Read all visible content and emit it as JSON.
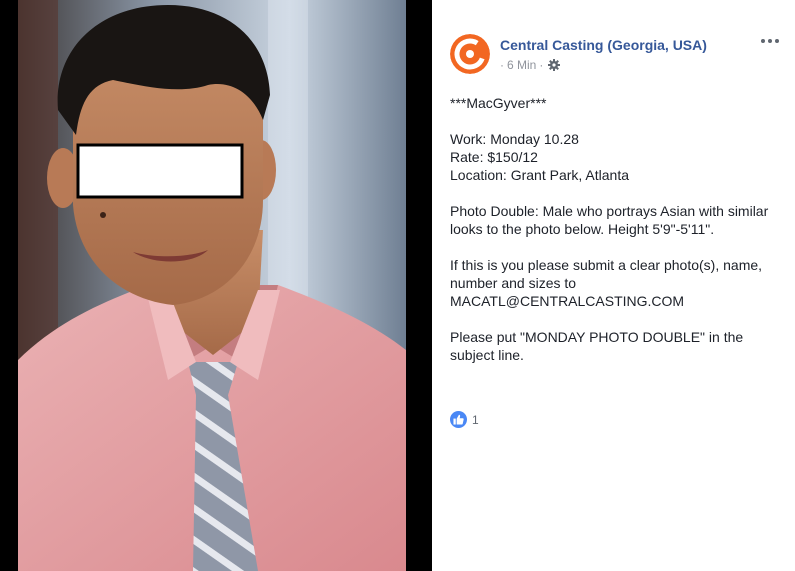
{
  "post": {
    "page_name": "Central Casting (Georgia, USA)",
    "meta_time": "6 Min",
    "meta_separator": "·",
    "lines": {
      "title": "***MacGyver***",
      "work": "Work: Monday 10.28",
      "rate": "Rate: $150/12",
      "location": "Location: Grant Park, Atlanta",
      "desc1": "Photo Double: Male who portrays Asian with similar",
      "desc2": "looks to the photo below. Height 5'9\"-5'11\".",
      "submit1": "If this is you please submit a clear photo(s), name,",
      "submit2": "number and sizes to",
      "email": "MACATL@CENTRALCASTING.COM",
      "subject1": "Please put \"MONDAY PHOTO DOUBLE\" in the",
      "subject2": "subject line."
    },
    "reaction_count": "1"
  },
  "icons": {
    "avatar": "central-casting-logo",
    "privacy": "gear-icon",
    "more": "more-options-icon",
    "reaction": "like-icon"
  },
  "colors": {
    "page_name": "#365899",
    "meta": "#90949c",
    "logo_orange": "#f26722",
    "shirt": "#e8a6a9",
    "like_blue": "#4a88f5"
  }
}
